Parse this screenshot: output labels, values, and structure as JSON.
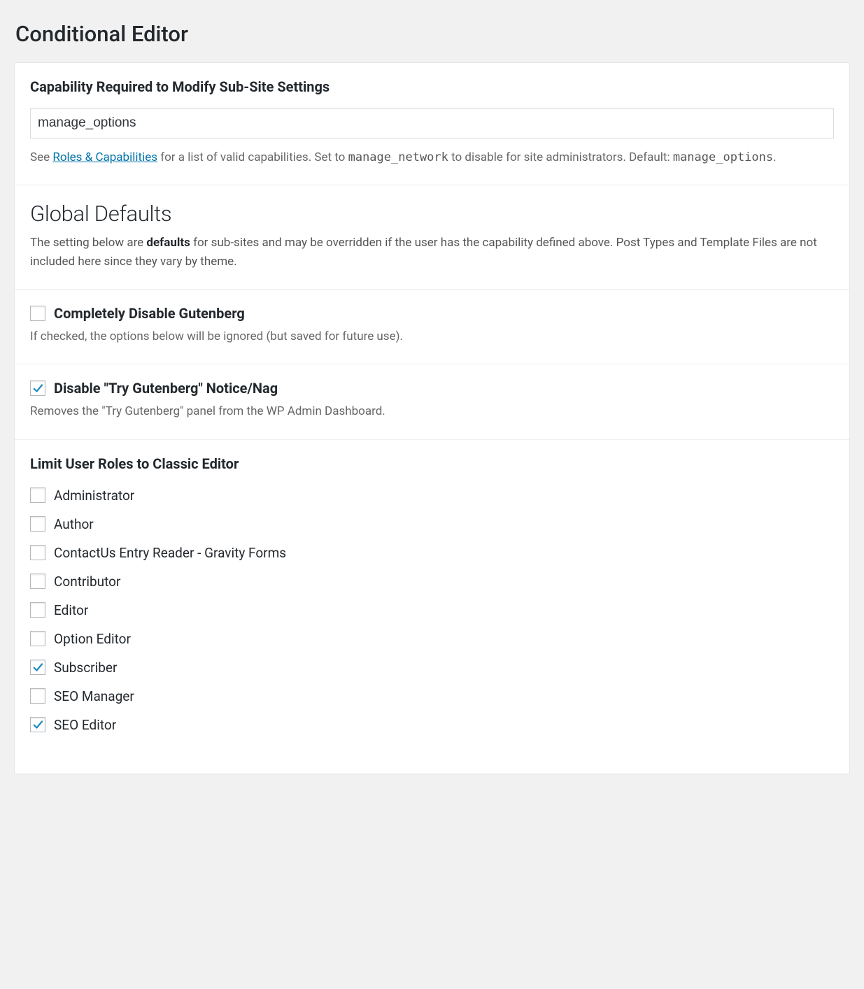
{
  "page_title": "Conditional Editor",
  "capability_section": {
    "title": "Capability Required to Modify Sub-Site Settings",
    "input_value": "manage_options",
    "desc_prefix": "See ",
    "desc_link_text": "Roles & Capabilities",
    "desc_mid1": " for a list of valid capabilities. Set to ",
    "code1": "manage_network",
    "desc_mid2": " to disable for site administrators. Default: ",
    "code2": "manage_options",
    "desc_end": "."
  },
  "global_defaults": {
    "title": "Global Defaults",
    "sub_prefix": "The setting below are ",
    "sub_bold": "defaults",
    "sub_suffix": " for sub-sites and may be overridden if the user has the capability defined above. Post Types and Template Files are not included here since they vary by theme."
  },
  "opt_disable_gutenberg": {
    "label": "Completely Disable Gutenberg",
    "checked": false,
    "desc": "If checked, the options below will be ignored (but saved for future use)."
  },
  "opt_disable_nag": {
    "label": "Disable \"Try Gutenberg\" Notice/Nag",
    "checked": true,
    "desc": "Removes the \"Try Gutenberg\" panel from the WP Admin Dashboard."
  },
  "roles_section": {
    "title": "Limit User Roles to Classic Editor",
    "roles": [
      {
        "label": "Administrator",
        "checked": false
      },
      {
        "label": "Author",
        "checked": false
      },
      {
        "label": "ContactUs Entry Reader - Gravity Forms",
        "checked": false
      },
      {
        "label": "Contributor",
        "checked": false
      },
      {
        "label": "Editor",
        "checked": false
      },
      {
        "label": "Option Editor",
        "checked": false
      },
      {
        "label": "Subscriber",
        "checked": true
      },
      {
        "label": "SEO Manager",
        "checked": false
      },
      {
        "label": "SEO Editor",
        "checked": true
      }
    ]
  }
}
